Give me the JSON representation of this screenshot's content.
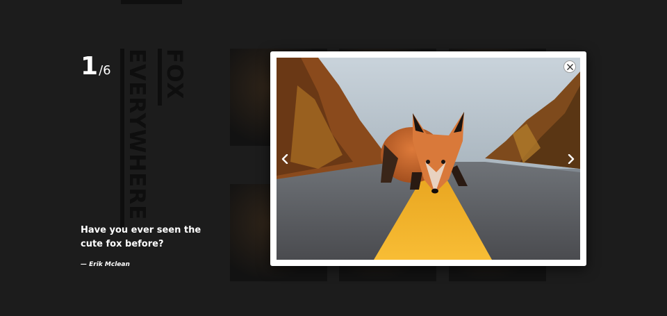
{
  "slide": {
    "current": "1",
    "total": "/6"
  },
  "titles": {
    "line1": "FOX",
    "line2": "EVERYWHERE"
  },
  "quote": {
    "text": "Have you ever seen the cute fox before?",
    "author": "— Erik Mclean"
  },
  "gallery": {
    "thumbnails": [
      "thumb-1",
      "thumb-2",
      "thumb-3",
      "thumb-4",
      "thumb-5",
      "thumb-6"
    ]
  },
  "lightbox": {
    "image_subject": "red fox on road with yellow center line",
    "close_icon": "close-icon",
    "prev_icon": "chevron-left-icon",
    "next_icon": "chevron-right-icon"
  },
  "colors": {
    "background": "#1c1c1c",
    "text": "#ffffff",
    "title_dark": "#0e0e0e",
    "road_line": "#f2b32a",
    "fox": "#c8662c"
  }
}
